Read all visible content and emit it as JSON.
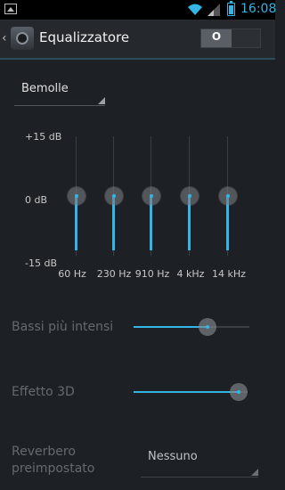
{
  "status_bar": {
    "time": "16:08",
    "icons": [
      "gallery-icon",
      "wifi-icon",
      "signal-icon",
      "battery-icon"
    ],
    "accent": "#33b5e5"
  },
  "action_bar": {
    "title": "Equalizzatore",
    "toggle_label": "O"
  },
  "preset": {
    "selected": "Bemolle"
  },
  "equalizer": {
    "db_max": "+15 dB",
    "db_mid": "0 dB",
    "db_min": "-15 dB",
    "bands": [
      {
        "freq": "60 Hz",
        "level_db": 0
      },
      {
        "freq": "230 Hz",
        "level_db": 0
      },
      {
        "freq": "910 Hz",
        "level_db": 0
      },
      {
        "freq": "4 kHz",
        "level_db": 0
      },
      {
        "freq": "14 kHz",
        "level_db": 0
      }
    ]
  },
  "bass_boost": {
    "label": "Bassi più intensi",
    "level": 0.66
  },
  "virtualizer": {
    "label": "Effetto 3D",
    "level": 1.0
  },
  "reverb": {
    "label": "Reverbero preimpostato",
    "selected": "Nessuno"
  },
  "colors": {
    "accent": "#33b5e5",
    "background": "#1d2024"
  }
}
